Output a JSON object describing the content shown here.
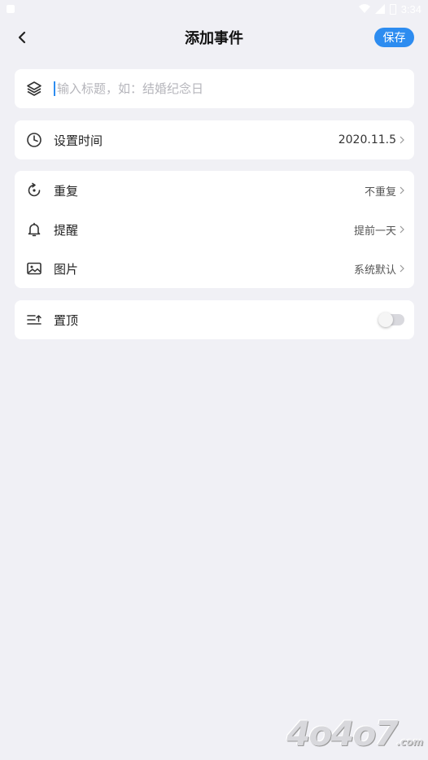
{
  "status_bar": {
    "time": "3:34"
  },
  "header": {
    "title": "添加事件",
    "save_label": "保存"
  },
  "title_field": {
    "placeholder": "输入标题，如：结婚纪念日",
    "value": ""
  },
  "time_row": {
    "label": "设置时间",
    "value": "2020.11.5"
  },
  "options": [
    {
      "label": "重复",
      "value": "不重复"
    },
    {
      "label": "提醒",
      "value": "提前一天"
    },
    {
      "label": "图片",
      "value": "系统默认"
    }
  ],
  "pin_row": {
    "label": "置顶",
    "enabled": false
  },
  "watermark": {
    "text": "4o4o7",
    "suffix": ".com"
  },
  "colors": {
    "accent": "#2d8cf0",
    "background": "#f0f0f5",
    "card": "#ffffff"
  }
}
